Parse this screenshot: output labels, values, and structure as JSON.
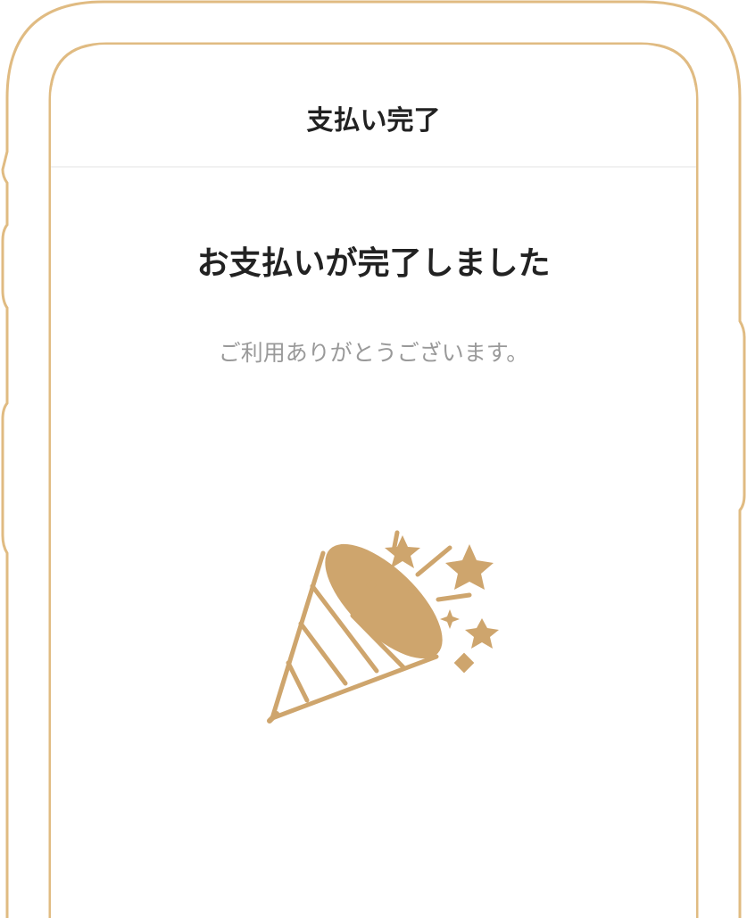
{
  "screen": {
    "nav_title": "支払い完了",
    "heading": "お支払いが完了しました",
    "message": "ご利用ありがとうございます。"
  },
  "illustration": {
    "icon": "party-popper-icon",
    "color": "#CEA56D"
  },
  "colors": {
    "frame": "#E0BB82",
    "title_text": "#222222",
    "sub_text": "#999999",
    "divider": "#F1F1F1"
  }
}
